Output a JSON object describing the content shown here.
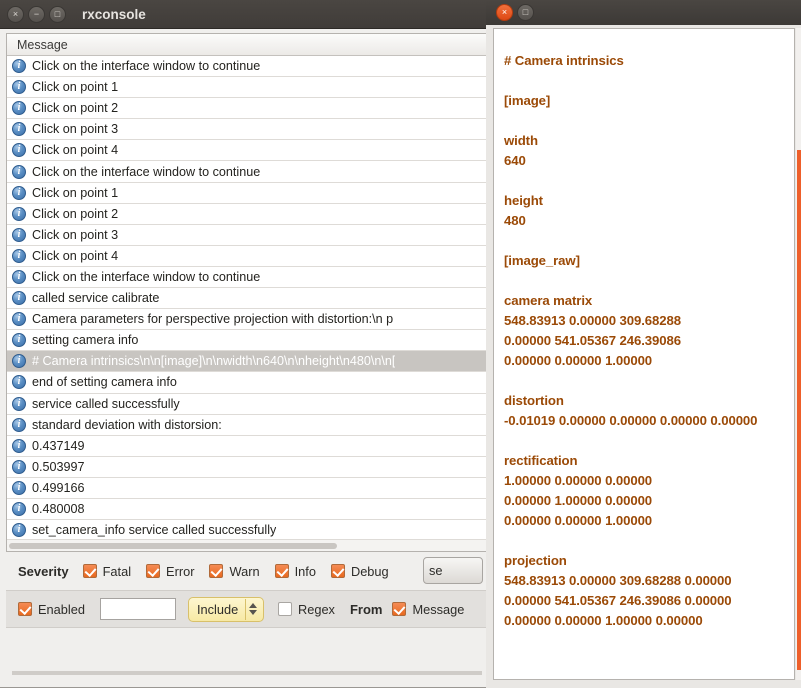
{
  "left_window": {
    "title": "rxconsole",
    "window_buttons": [
      {
        "name": "close",
        "glyph": "×"
      },
      {
        "name": "minimize",
        "glyph": "−"
      },
      {
        "name": "maximize",
        "glyph": "□"
      }
    ],
    "table": {
      "column_header": "Message",
      "rows": [
        {
          "level": "info",
          "text": "Click on the interface window to continue",
          "selected": false
        },
        {
          "level": "info",
          "text": "Click on point 1",
          "selected": false
        },
        {
          "level": "info",
          "text": "Click on point 2",
          "selected": false
        },
        {
          "level": "info",
          "text": "Click on point 3",
          "selected": false
        },
        {
          "level": "info",
          "text": "Click on point 4",
          "selected": false
        },
        {
          "level": "info",
          "text": "Click on the interface window to continue",
          "selected": false
        },
        {
          "level": "info",
          "text": "Click on point 1",
          "selected": false
        },
        {
          "level": "info",
          "text": "Click on point 2",
          "selected": false
        },
        {
          "level": "info",
          "text": "Click on point 3",
          "selected": false
        },
        {
          "level": "info",
          "text": "Click on point 4",
          "selected": false
        },
        {
          "level": "info",
          "text": "Click on the interface window to continue",
          "selected": false
        },
        {
          "level": "info",
          "text": "called service calibrate",
          "selected": false
        },
        {
          "level": "info",
          "text": "Camera parameters for perspective projection with distortion:\\n  p",
          "selected": false
        },
        {
          "level": "info",
          "text": "setting camera info",
          "selected": false
        },
        {
          "level": "info",
          "text": "# Camera intrinsics\\n\\n[image]\\n\\nwidth\\n640\\n\\nheight\\n480\\n\\n[",
          "selected": true
        },
        {
          "level": "info",
          "text": "end of setting camera info",
          "selected": false
        },
        {
          "level": "info",
          "text": "service called successfully",
          "selected": false
        },
        {
          "level": "info",
          "text": "standard deviation with distorsion:",
          "selected": false
        },
        {
          "level": "info",
          "text": "0.437149",
          "selected": false
        },
        {
          "level": "info",
          "text": "0.503997",
          "selected": false
        },
        {
          "level": "info",
          "text": "0.499166",
          "selected": false
        },
        {
          "level": "info",
          "text": "0.480008",
          "selected": false
        },
        {
          "level": "info",
          "text": "set_camera_info service called successfully",
          "selected": false
        }
      ]
    },
    "severity_bar": {
      "label": "Severity",
      "checkboxes": [
        {
          "label": "Fatal",
          "checked": true
        },
        {
          "label": "Error",
          "checked": true
        },
        {
          "label": "Warn",
          "checked": true
        },
        {
          "label": "Info",
          "checked": true
        },
        {
          "label": "Debug",
          "checked": true
        }
      ],
      "pause_button": "se"
    },
    "filter_bar": {
      "enabled_label": "Enabled",
      "enabled_checked": true,
      "text_value": "",
      "text_placeholder": "",
      "mode_select": "Include",
      "regex_label": "Regex",
      "regex_checked": false,
      "from_label": "From",
      "message_label": "Message",
      "message_checked": true
    }
  },
  "right_window": {
    "window_buttons": [
      {
        "name": "close",
        "glyph": "×"
      },
      {
        "name": "maximize",
        "glyph": "□"
      }
    ],
    "lines": [
      "# Camera intrinsics",
      "",
      "[image]",
      "",
      "width",
      "640",
      "",
      "height",
      "480",
      "",
      "[image_raw]",
      "",
      "camera matrix",
      "548.83913 0.00000 309.68288",
      "0.00000 541.05367 246.39086",
      "0.00000 0.00000 1.00000",
      "",
      "distortion",
      "-0.01019 0.00000 0.00000 0.00000 0.00000",
      "",
      "rectification",
      "1.00000 0.00000 0.00000",
      "0.00000 1.00000 0.00000",
      "0.00000 0.00000 1.00000",
      "",
      "projection",
      "548.83913 0.00000 309.68288 0.00000",
      "0.00000 541.05367 246.39086 0.00000",
      "0.00000 0.00000 1.00000 0.00000"
    ]
  },
  "colors": {
    "accent_orange": "#dd4814",
    "info_blue": "#3a6ea8",
    "intrinsics_text": "#9b4a07",
    "scrollbar_orange": "#ee5f2a"
  }
}
